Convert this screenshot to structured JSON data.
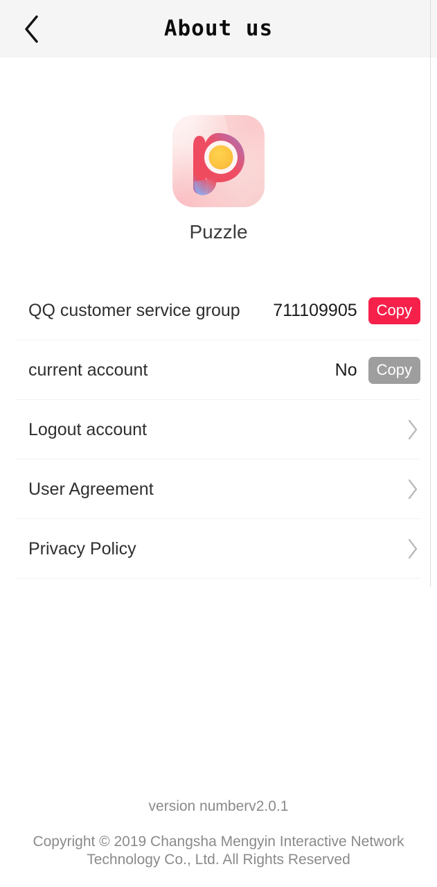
{
  "header": {
    "title": "About us",
    "back_icon": "chevron-left-icon"
  },
  "brand": {
    "logo_icon": "puzzle-app-logo",
    "app_name": "Puzzle"
  },
  "list": {
    "rows": [
      {
        "label": "QQ customer service group",
        "value": "711109905",
        "action_label": "Copy",
        "action_state": "enabled",
        "type": "value"
      },
      {
        "label": "current account",
        "value": "No",
        "action_label": "Copy",
        "action_state": "disabled",
        "type": "value"
      },
      {
        "label": "Logout account",
        "chevron_icon": "chevron-right-icon",
        "type": "nav"
      },
      {
        "label": "User Agreement",
        "chevron_icon": "chevron-right-icon",
        "type": "nav"
      },
      {
        "label": "Privacy Policy",
        "chevron_icon": "chevron-right-icon",
        "type": "nav"
      }
    ]
  },
  "footer": {
    "version": "version numberv2.0.1",
    "copyright": "Copyright © 2019 Changsha Mengyin Interactive Network Technology Co., Ltd. All Rights Reserved"
  },
  "colors": {
    "accent": "#f5214b",
    "disabled": "#9e9e9e",
    "header_bg": "#f5f5f6",
    "divider": "#f2f2f4",
    "text_primary": "#2f2f2f",
    "text_muted": "#8a8a8a"
  }
}
